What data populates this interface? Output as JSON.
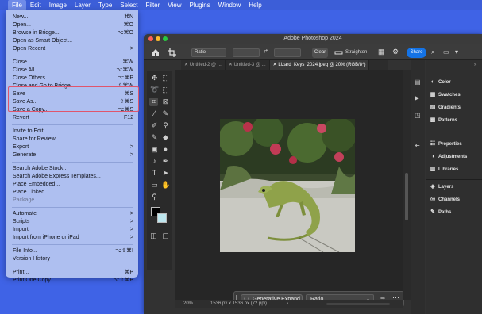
{
  "menubar": {
    "items": [
      "File",
      "Edit",
      "Image",
      "Layer",
      "Type",
      "Select",
      "Filter",
      "View",
      "Plugins",
      "Window",
      "Help"
    ]
  },
  "file_menu": {
    "groups": [
      [
        {
          "label": "New...",
          "shortcut": "⌘N"
        },
        {
          "label": "Open...",
          "shortcut": "⌘O"
        },
        {
          "label": "Browse in Bridge...",
          "shortcut": "⌥⌘O"
        },
        {
          "label": "Open as Smart Object...",
          "shortcut": ""
        },
        {
          "label": "Open Recent",
          "shortcut": ">"
        }
      ],
      [
        {
          "label": "Close",
          "shortcut": "⌘W"
        },
        {
          "label": "Close All",
          "shortcut": "⌥⌘W"
        },
        {
          "label": "Close Others",
          "shortcut": "⌥⌘P"
        },
        {
          "label": "Close and Go to Bridge...",
          "shortcut": "⇧⌘W"
        },
        {
          "label": "Save",
          "shortcut": "⌘S"
        },
        {
          "label": "Save As...",
          "shortcut": "⇧⌘S"
        },
        {
          "label": "Save a Copy...",
          "shortcut": "⌥⌘S"
        },
        {
          "label": "Revert",
          "shortcut": "F12"
        }
      ],
      [
        {
          "label": "Invite to Edit...",
          "shortcut": ""
        },
        {
          "label": "Share for Review",
          "shortcut": ""
        },
        {
          "label": "Export",
          "shortcut": ">"
        },
        {
          "label": "Generate",
          "shortcut": ">"
        }
      ],
      [
        {
          "label": "Search Adobe Stock...",
          "shortcut": ""
        },
        {
          "label": "Search Adobe Express Templates...",
          "shortcut": ""
        },
        {
          "label": "Place Embedded...",
          "shortcut": ""
        },
        {
          "label": "Place Linked...",
          "shortcut": ""
        },
        {
          "label": "Package...",
          "shortcut": "",
          "disabled": true
        }
      ],
      [
        {
          "label": "Automate",
          "shortcut": ">"
        },
        {
          "label": "Scripts",
          "shortcut": ">"
        },
        {
          "label": "Import",
          "shortcut": ">"
        },
        {
          "label": "Import from iPhone or iPad",
          "shortcut": ">"
        }
      ],
      [
        {
          "label": "File Info...",
          "shortcut": "⌥⇧⌘I"
        },
        {
          "label": "Version History",
          "shortcut": ""
        }
      ],
      [
        {
          "label": "Print...",
          "shortcut": "⌘P"
        },
        {
          "label": "Print One Copy",
          "shortcut": "⌥⇧⌘P"
        }
      ]
    ]
  },
  "photoshop": {
    "title": "Adobe Photoshop 2024",
    "options": {
      "ratio_label": "Ratio",
      "clear_label": "Clear",
      "straighten_label": "Straighten",
      "share_label": "Share"
    },
    "tabs": [
      {
        "label": "Untitled-2 @ ...",
        "active": false
      },
      {
        "label": "Untitled-3 @ ...",
        "active": false
      },
      {
        "label": "Lizard_Keys_2024.jpeg @ 20% (RGB/8*)",
        "active": true
      }
    ],
    "generative_bar": {
      "button_label": "Generative Expand",
      "select_value": "Ratio"
    },
    "status": {
      "zoom": "20%",
      "doc_info": "1536 px x 1536 px (72 ppi)"
    },
    "panels": [
      {
        "label": "Color",
        "icon": "color-icon"
      },
      {
        "label": "Swatches",
        "icon": "swatches-icon"
      },
      {
        "label": "Gradients",
        "icon": "gradients-icon"
      },
      {
        "label": "Patterns",
        "icon": "patterns-icon"
      },
      {
        "label": "Properties",
        "icon": "properties-icon"
      },
      {
        "label": "Adjustments",
        "icon": "adjustments-icon"
      },
      {
        "label": "Libraries",
        "icon": "libraries-icon"
      },
      {
        "label": "Layers",
        "icon": "layers-icon"
      },
      {
        "label": "Channels",
        "icon": "channels-icon"
      },
      {
        "label": "Paths",
        "icon": "paths-icon"
      }
    ]
  },
  "colors": {
    "menubar": "#3c5ed8",
    "menu_bg": "#aebff0",
    "highlight": "#e0556c",
    "share": "#1473e6"
  }
}
